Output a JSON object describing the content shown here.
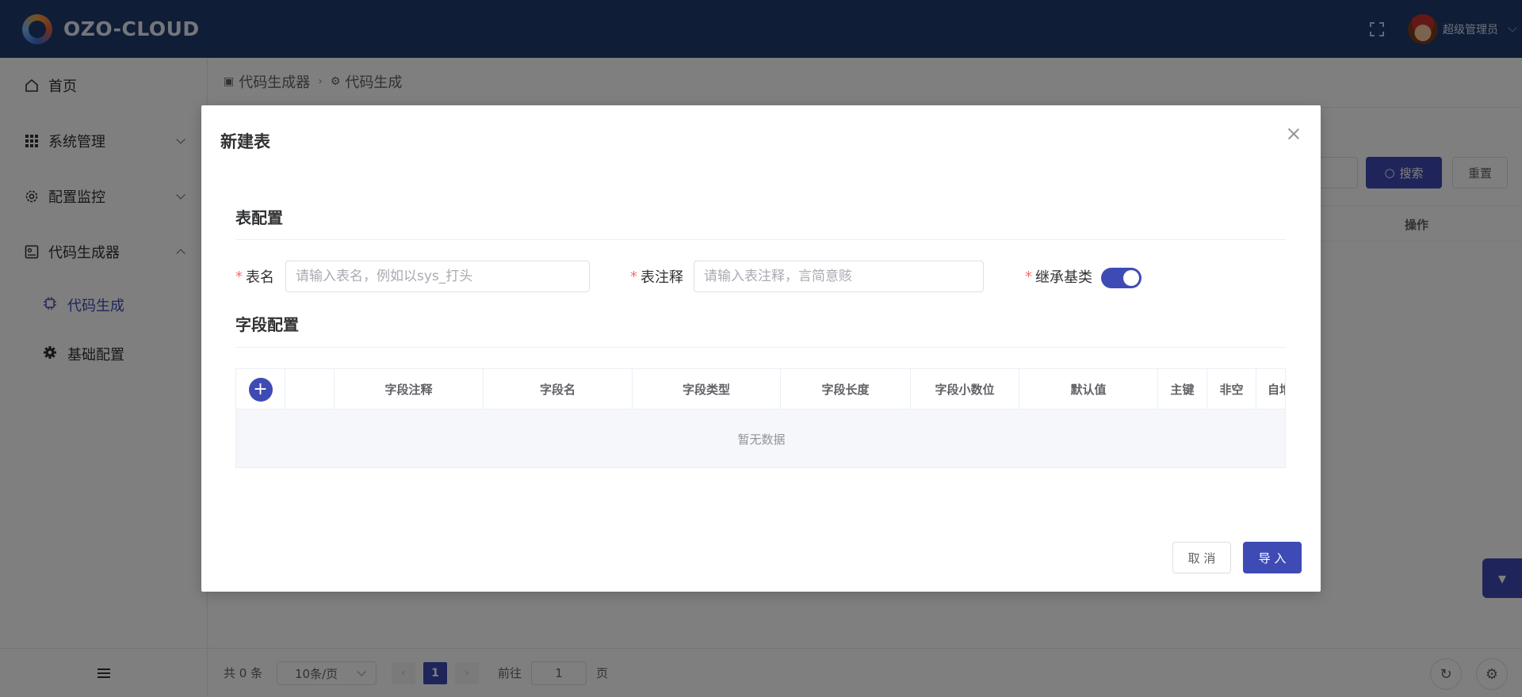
{
  "header": {
    "logo_text": "OZO-CLOUD",
    "user_name": "超级管理员"
  },
  "sidebar": {
    "items": [
      {
        "label": "首页",
        "icon": "home-icon"
      },
      {
        "label": "系统管理",
        "icon": "grid-icon"
      },
      {
        "label": "配置监控",
        "icon": "gear-icon"
      },
      {
        "label": "代码生成器",
        "icon": "dashboard-icon"
      }
    ],
    "sub_items": [
      {
        "label": "代码生成",
        "icon": "chip-icon",
        "active": true
      },
      {
        "label": "基础配置",
        "icon": "cog-icon",
        "active": false
      }
    ]
  },
  "breadcrumb": {
    "items": [
      "代码生成器",
      "代码生成"
    ]
  },
  "toolbar": {
    "search_label": "搜索",
    "reset_label": "重置"
  },
  "background_table": {
    "op_header": "操作"
  },
  "pager": {
    "total": "共 0 条",
    "page_size": "10条/页",
    "current_page": "1",
    "goto_label": "前往",
    "goto_value": "1",
    "goto_unit": "页"
  },
  "dialog": {
    "title": "新建表",
    "table_section": "表配置",
    "field_section": "字段配置",
    "fields": {
      "table_name_label": "表名",
      "table_name_placeholder": "请输入表名，例如以sys_打头",
      "table_comment_label": "表注释",
      "table_comment_placeholder": "请输入表注释，言简意赅",
      "inherit_label": "继承基类",
      "inherit_on": true
    },
    "columns": [
      "字段注释",
      "字段名",
      "字段类型",
      "字段长度",
      "字段小数位",
      "默认值",
      "主键",
      "非空",
      "自增"
    ],
    "empty_text": "暂无数据",
    "cancel_label": "取 消",
    "import_label": "导 入"
  },
  "colors": {
    "primary": "#3f4bb5",
    "header_bg": "#1f3a6e",
    "required": "#f56c6c"
  }
}
